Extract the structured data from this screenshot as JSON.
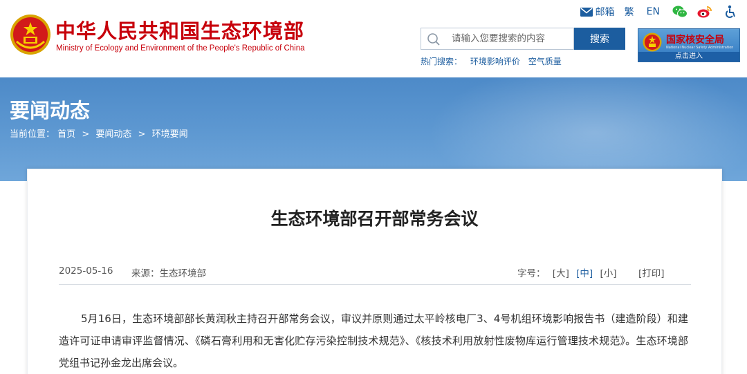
{
  "header": {
    "title": "中华人民共和国生态环境部",
    "subtitle": "Ministry of Ecology and Environment of the People's Republic of China",
    "top_links": {
      "mail": "邮箱",
      "traditional": "繁",
      "english": "EN"
    },
    "search": {
      "placeholder": "请输入您要搜索的内容",
      "button": "搜索",
      "hot_label": "热门搜索：",
      "hot_items": [
        "环境影响评价",
        "空气质量"
      ]
    },
    "nnsa": {
      "title": "国家核安全局",
      "subtitle": "National Nuclear Safety Administration",
      "enter": "点击进入"
    }
  },
  "hero": {
    "title": "要闻动态",
    "breadcrumb_label": "当前位置：",
    "crumbs": [
      "首页",
      "要闻动态",
      "环境要闻"
    ],
    "sep": ">"
  },
  "article": {
    "title": "生态环境部召开部常务会议",
    "date": "2025-05-16",
    "source": "来源：生态环境部",
    "fontsize_label": "字号：",
    "fontsize": [
      "[大]",
      "[中]",
      "[小]"
    ],
    "print": "[打印]",
    "body": "5月16日，生态环境部部长黄润秋主持召开部常务会议，审议并原则通过太平岭核电厂3、4号机组环境影响报告书（建造阶段）和建造许可证申请审评监督情况、《磷石膏利用和无害化贮存污染控制技术规范》、《核技术利用放射性废物库运行管理技术规范》。生态环境部党组书记孙金龙出席会议。"
  },
  "colors": {
    "brand_red": "#c7000b",
    "brand_blue": "#1c5d9f",
    "hero_blue": "#5b96d0"
  }
}
